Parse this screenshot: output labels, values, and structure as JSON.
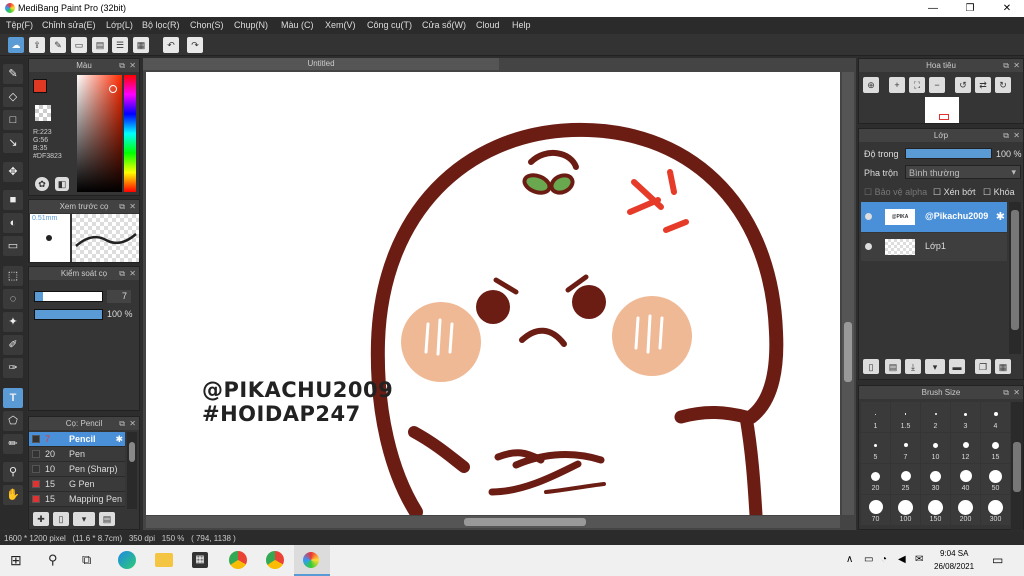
{
  "window": {
    "title": "MediBang Paint Pro (32bit)",
    "minimize": "—",
    "maximize": "❐",
    "close": "✕"
  },
  "menu": [
    "Tệp(F)",
    "Chỉnh sửa(E)",
    "Lớp(L)",
    "Bộ lọc(R)",
    "Chọn(S)",
    "Chụp(N)",
    "Màu (C)",
    "Xem(V)",
    "Công cụ(T)",
    "Cửa sổ(W)",
    "Cloud",
    "Help"
  ],
  "color_panel": {
    "title": "Màu",
    "r": "R:223",
    "g": "G:56",
    "b": "B:35",
    "hex": "#DF3823",
    "fg_color": "#DF3823"
  },
  "brush_preview": {
    "title": "Xem trước cọ",
    "size": "0.51mm"
  },
  "brush_control": {
    "title": "Kiểm soát cọ",
    "size_value": "7",
    "opacity_value": "100 %",
    "opacity_level": 1.0
  },
  "brush_list": {
    "title": "Cọ: Pencil",
    "items": [
      {
        "size": "7",
        "name": "Pencil",
        "color": "#333333",
        "selected": true
      },
      {
        "size": "20",
        "name": "Pen",
        "color": "#333333",
        "selected": false
      },
      {
        "size": "10",
        "name": "Pen (Sharp)",
        "color": "#333333",
        "selected": false
      },
      {
        "size": "15",
        "name": "G Pen",
        "color": "#e53030",
        "selected": false
      },
      {
        "size": "15",
        "name": "Mapping Pen",
        "color": "#e53030",
        "selected": false
      }
    ]
  },
  "canvas": {
    "tab": "Untitled",
    "text_line1": "@PIKACHU2009",
    "text_line2": "#HOIDAP247"
  },
  "navigator": {
    "title": "Hoa tiêu"
  },
  "layers": {
    "title": "Lớp",
    "opacity_label": "Độ trong",
    "opacity_value": "100 %",
    "blend_label": "Pha trộn",
    "blend_value": "Bình thường",
    "alpha_protect": "Bảo vệ alpha",
    "clipping": "Xén bớt",
    "lock": "Khóa",
    "items": [
      {
        "name": "@Pikachu2009",
        "selected": true
      },
      {
        "name": "Lớp1",
        "selected": false
      }
    ]
  },
  "brush_size": {
    "title": "Brush Size",
    "sizes": [
      "1",
      "1.5",
      "2",
      "3",
      "4",
      "5",
      "7",
      "10",
      "12",
      "15",
      "20",
      "25",
      "30",
      "40",
      "50",
      "70",
      "100",
      "150",
      "200",
      "300"
    ]
  },
  "status": {
    "text": "1600 * 1200 pixel   (11.6 * 8.7cm)   350 dpi   150 %   ( 794, 1138 )"
  },
  "taskbar": {
    "time": "9:04 SA",
    "date": "26/08/2021"
  },
  "colors": {
    "accent": "#5b9bd5",
    "selected_layer": "#4a90d9",
    "face_outline": "#6b1d14",
    "cheek": "#f0b995",
    "leaf": "#6aa84f",
    "anger": "#e53b28"
  }
}
